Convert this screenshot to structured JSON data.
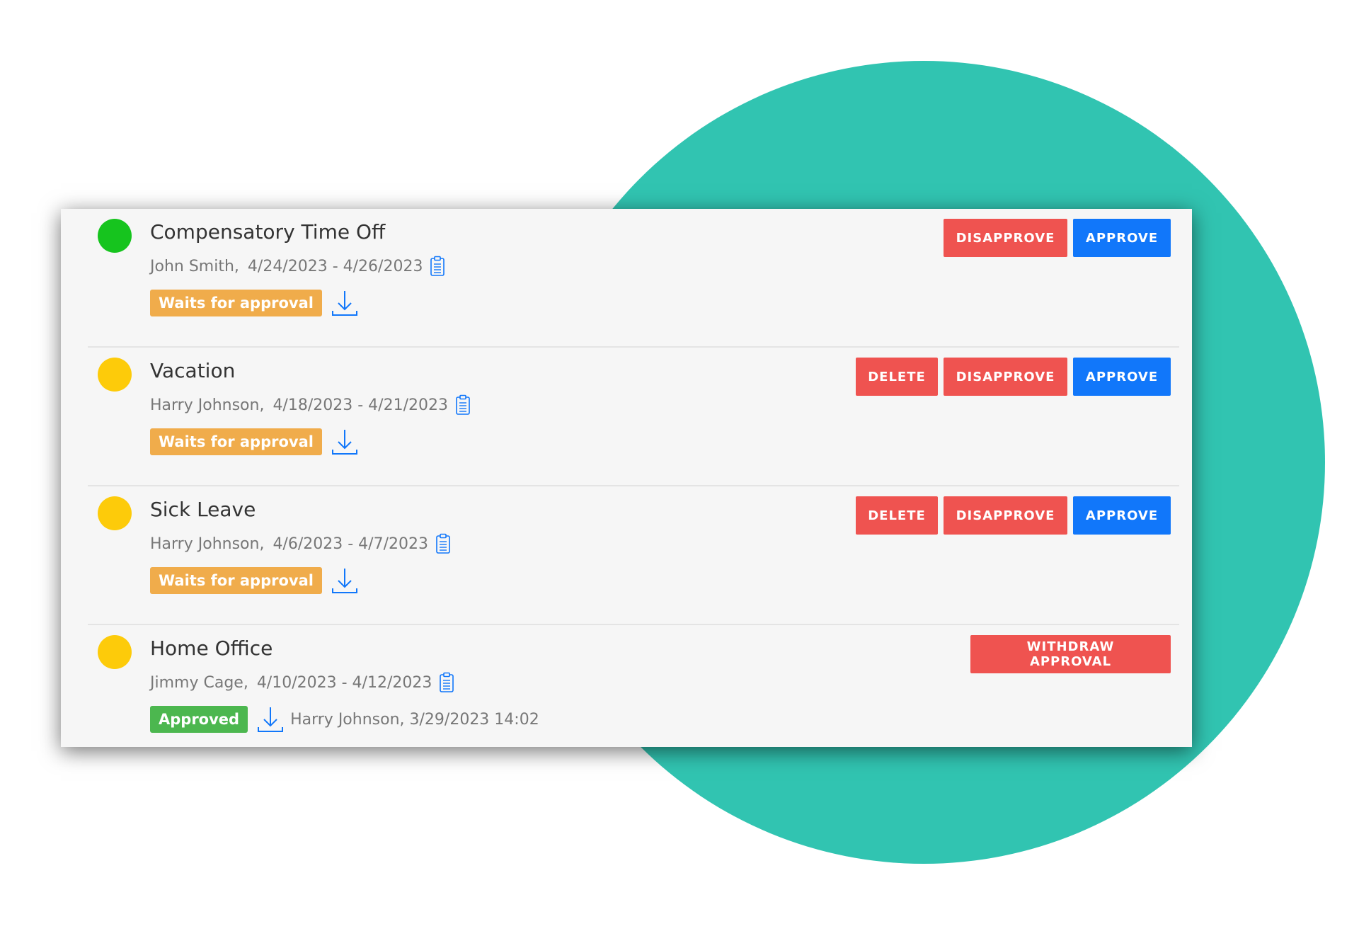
{
  "colors": {
    "teal": "#31c4b1",
    "green_dot": "#16c41e",
    "yellow_dot": "#fdcb0a",
    "waiting_badge": "#f0ac4b",
    "approved_badge": "#4cb74f",
    "danger": "#ef5350",
    "primary": "#1177fa"
  },
  "requests": [
    {
      "title": "Compensatory Time Off",
      "person": "John Smith,",
      "dates": "4/24/2023 - 4/26/2023",
      "status": "Waits for approval",
      "dot_color": "#16c41e",
      "buttons": {
        "disapprove": "DISAPPROVE",
        "approve": "APPROVE"
      }
    },
    {
      "title": "Vacation",
      "person": "Harry Johnson,",
      "dates": "4/18/2023 - 4/21/2023",
      "status": "Waits for approval",
      "dot_color": "#fdcb0a",
      "buttons": {
        "delete": "DELETE",
        "disapprove": "DISAPPROVE",
        "approve": "APPROVE"
      }
    },
    {
      "title": "Sick Leave",
      "person": "Harry Johnson,",
      "dates": "4/6/2023 - 4/7/2023",
      "status": "Waits for approval",
      "dot_color": "#fdcb0a",
      "buttons": {
        "delete": "DELETE",
        "disapprove": "DISAPPROVE",
        "approve": "APPROVE"
      }
    },
    {
      "title": "Home Office",
      "person": "Jimmy Cage,",
      "dates": "4/10/2023 - 4/12/2023",
      "status": "Approved",
      "approved_by": "Harry Johnson, 3/29/2023 14:02",
      "dot_color": "#fdcb0a",
      "buttons": {
        "withdraw": "WITHDRAW APPROVAL"
      }
    }
  ],
  "icons": {
    "note": "clipboard-icon",
    "download": "download-icon"
  }
}
